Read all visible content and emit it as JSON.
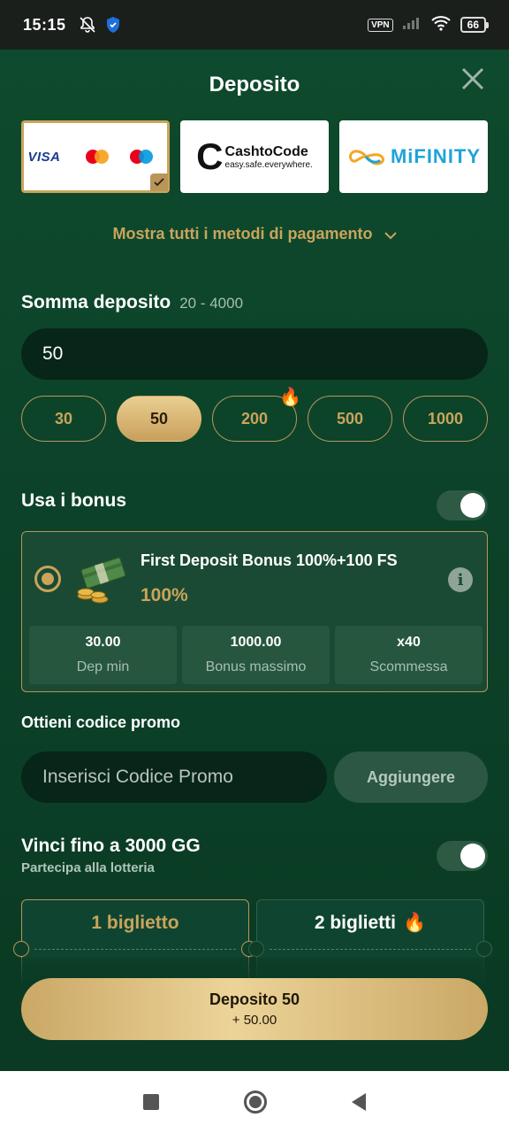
{
  "status": {
    "time": "15:15",
    "vpn": "VPN",
    "battery": "66"
  },
  "header": {
    "title": "Deposito"
  },
  "payment_methods": {
    "visa_label": "VISA",
    "cashtocode_name": "CashtoCode",
    "cashtocode_tagline": "easy.safe.everywhere.",
    "mifinity_name": "MiFINITY",
    "show_all": "Mostra tutti i metodi di pagamento"
  },
  "amount": {
    "label": "Somma deposito",
    "range": "20 - 4000",
    "value": "50",
    "chips": [
      "30",
      "50",
      "200",
      "500",
      "1000"
    ],
    "selected": "50"
  },
  "bonus": {
    "toggle_label": "Usa i bonus",
    "toggle_on": true,
    "title": "First Deposit Bonus 100%+100 FS",
    "percent": "100%",
    "info": "i",
    "stats": [
      {
        "value": "30.00",
        "label": "Dep min"
      },
      {
        "value": "1000.00",
        "label": "Bonus massimo"
      },
      {
        "value": "x40",
        "label": "Scommessa"
      }
    ]
  },
  "promo": {
    "label": "Ottieni codice promo",
    "placeholder": "Inserisci Codice Promo",
    "button": "Aggiungere"
  },
  "lottery": {
    "title": "Vinci fino a 3000 GG",
    "subtitle": "Partecipa alla lotteria",
    "toggle_on": true,
    "tickets": [
      "1 biglietto",
      "2 biglietti"
    ]
  },
  "deposit_button": {
    "label": "Deposito 50",
    "bonus": "+ 50.00"
  },
  "colors": {
    "accent_gold": "#c9a45c",
    "background": "#0d3a24"
  }
}
